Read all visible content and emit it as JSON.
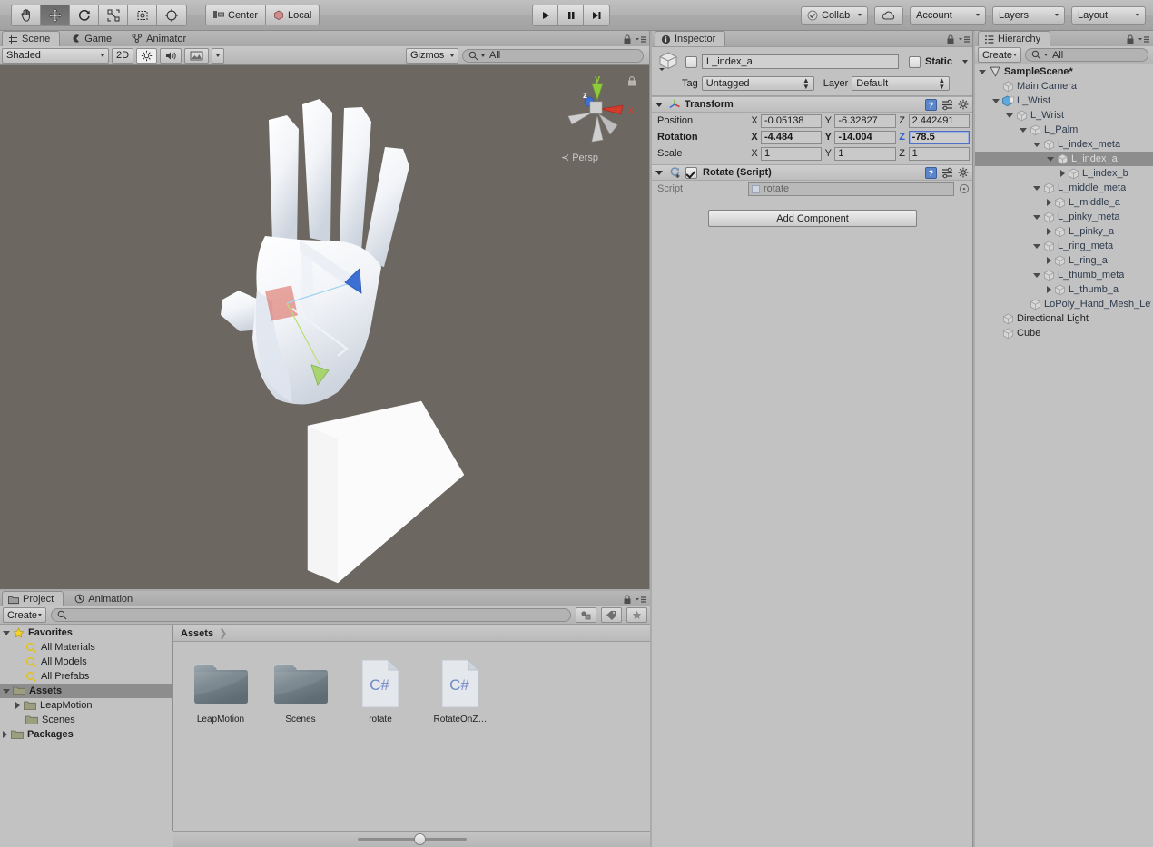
{
  "toolbar": {
    "tools": [
      {
        "name": "hand-tool",
        "icon": "hand",
        "selected": false
      },
      {
        "name": "move-tool",
        "icon": "move",
        "selected": true
      },
      {
        "name": "rotate-tool",
        "icon": "rotate",
        "selected": false
      },
      {
        "name": "scale-tool",
        "icon": "scale",
        "selected": false
      },
      {
        "name": "rect-tool",
        "icon": "rect",
        "selected": false
      },
      {
        "name": "transform-tool",
        "icon": "transform",
        "selected": false
      }
    ],
    "pivot_label": "Center",
    "space_label": "Local",
    "play_label": "play-icon",
    "pause_label": "pause-icon",
    "step_label": "step-icon",
    "collab_label": "Collab",
    "cloud_label": "cloud-icon",
    "account_label": "Account",
    "layers_label": "Layers",
    "layout_label": "Layout"
  },
  "scene": {
    "tabs": [
      {
        "label": "Scene",
        "icon": "grid-icon",
        "selected": true
      },
      {
        "label": "Game",
        "icon": "gamepad-icon",
        "selected": false
      },
      {
        "label": "Animator",
        "icon": "animator-icon",
        "selected": false
      }
    ],
    "draw_mode": "Shaded",
    "mode_2d": "2D",
    "lighting_icon": "sun-icon",
    "audio_icon": "speaker-icon",
    "fx_icon": "image-icon",
    "gizmos_label": "Gizmos",
    "search_placeholder": "All",
    "gizmo_axes": {
      "x": "x",
      "y": "y",
      "z": "z"
    },
    "projection_label": "Persp"
  },
  "inspector": {
    "tab_label": "Inspector",
    "object_name": "L_index_a",
    "object_enabled": false,
    "static_label": "Static",
    "static_checked": false,
    "tag_label": "Tag",
    "tag_value": "Untagged",
    "layer_label": "Layer",
    "layer_value": "Default",
    "transform": {
      "title": "Transform",
      "rows": [
        {
          "label": "Position",
          "bold": false,
          "x": "-0.05138",
          "y": "-6.32827",
          "z": "2.442491",
          "focused_axis": null
        },
        {
          "label": "Rotation",
          "bold": true,
          "x": "-4.484",
          "y": "-14.004",
          "z": "-78.5",
          "focused_axis": "z"
        },
        {
          "label": "Scale",
          "bold": false,
          "x": "1",
          "y": "1",
          "z": "1",
          "focused_axis": null
        }
      ]
    },
    "script_component": {
      "title": "Rotate (Script)",
      "enabled": true,
      "script_label": "Script",
      "script_value": "rotate"
    },
    "add_component_label": "Add Component"
  },
  "hierarchy": {
    "tab_label": "Hierarchy",
    "create_label": "Create",
    "search_placeholder": "All",
    "items": [
      {
        "label": "SampleScene*",
        "depth": 0,
        "twirl": "open",
        "type": "scene",
        "selected": false
      },
      {
        "label": "Main Camera",
        "depth": 1,
        "twirl": "none",
        "type": "go",
        "selected": false
      },
      {
        "label": "L_Wrist",
        "depth": 1,
        "twirl": "open",
        "type": "prefab",
        "selected": false
      },
      {
        "label": "L_Wrist",
        "depth": 2,
        "twirl": "open",
        "type": "go",
        "selected": false
      },
      {
        "label": "L_Palm",
        "depth": 3,
        "twirl": "open",
        "type": "go",
        "selected": false
      },
      {
        "label": "L_index_meta",
        "depth": 4,
        "twirl": "open",
        "type": "go",
        "selected": false
      },
      {
        "label": "L_index_a",
        "depth": 5,
        "twirl": "open",
        "type": "go",
        "selected": true
      },
      {
        "label": "L_index_b",
        "depth": 6,
        "twirl": "closed",
        "type": "go",
        "selected": false
      },
      {
        "label": "L_middle_meta",
        "depth": 4,
        "twirl": "open",
        "type": "go",
        "selected": false
      },
      {
        "label": "L_middle_a",
        "depth": 5,
        "twirl": "closed",
        "type": "go",
        "selected": false
      },
      {
        "label": "L_pinky_meta",
        "depth": 4,
        "twirl": "open",
        "type": "go",
        "selected": false
      },
      {
        "label": "L_pinky_a",
        "depth": 5,
        "twirl": "closed",
        "type": "go",
        "selected": false
      },
      {
        "label": "L_ring_meta",
        "depth": 4,
        "twirl": "open",
        "type": "go",
        "selected": false
      },
      {
        "label": "L_ring_a",
        "depth": 5,
        "twirl": "closed",
        "type": "go",
        "selected": false
      },
      {
        "label": "L_thumb_meta",
        "depth": 4,
        "twirl": "open",
        "type": "go",
        "selected": false
      },
      {
        "label": "L_thumb_a",
        "depth": 5,
        "twirl": "closed",
        "type": "go",
        "selected": false
      },
      {
        "label": "LoPoly_Hand_Mesh_Lef",
        "depth": 3,
        "twirl": "none",
        "type": "go",
        "selected": false
      },
      {
        "label": "Directional Light",
        "depth": 1,
        "twirl": "none",
        "type": "go-plain",
        "selected": false
      },
      {
        "label": "Cube",
        "depth": 1,
        "twirl": "none",
        "type": "go-plain",
        "selected": false
      }
    ]
  },
  "project": {
    "tabs": [
      {
        "label": "Project",
        "icon": "folder-icon",
        "selected": true
      },
      {
        "label": "Animation",
        "icon": "clock-icon",
        "selected": false
      }
    ],
    "create_label": "Create",
    "search_placeholder": "",
    "tree": [
      {
        "label": "Favorites",
        "depth": 0,
        "twirl": "open",
        "icon": "star-icon",
        "bold": true,
        "selected": false
      },
      {
        "label": "All Materials",
        "depth": 1,
        "twirl": "none",
        "icon": "search-icon",
        "bold": false,
        "selected": false
      },
      {
        "label": "All Models",
        "depth": 1,
        "twirl": "none",
        "icon": "search-icon",
        "bold": false,
        "selected": false
      },
      {
        "label": "All Prefabs",
        "depth": 1,
        "twirl": "none",
        "icon": "search-icon",
        "bold": false,
        "selected": false
      },
      {
        "label": "Assets",
        "depth": 0,
        "twirl": "open",
        "icon": "folder-icon",
        "bold": true,
        "selected": true
      },
      {
        "label": "LeapMotion",
        "depth": 1,
        "twirl": "closed",
        "icon": "folder-icon",
        "bold": false,
        "selected": false
      },
      {
        "label": "Scenes",
        "depth": 1,
        "twirl": "none",
        "icon": "folder-icon",
        "bold": false,
        "selected": false
      },
      {
        "label": "Packages",
        "depth": 0,
        "twirl": "closed",
        "icon": "folder-icon",
        "bold": true,
        "selected": false
      }
    ],
    "breadcrumb": "Assets",
    "assets": [
      {
        "label": "LeapMotion",
        "type": "folder"
      },
      {
        "label": "Scenes",
        "type": "folder"
      },
      {
        "label": "rotate",
        "type": "csharp"
      },
      {
        "label": "RotateOnZ…",
        "type": "csharp"
      }
    ]
  },
  "colors": {
    "scene_bg": "#6d6761",
    "panel_bg": "#c2c2c2",
    "toolbar_bg": "#b2b2b2",
    "selection": "#8d8d8d",
    "axis_x": "#d33b2c",
    "axis_y": "#8ecb3a",
    "axis_z": "#3b6fd4",
    "link_blue": "#2d3b4d"
  }
}
